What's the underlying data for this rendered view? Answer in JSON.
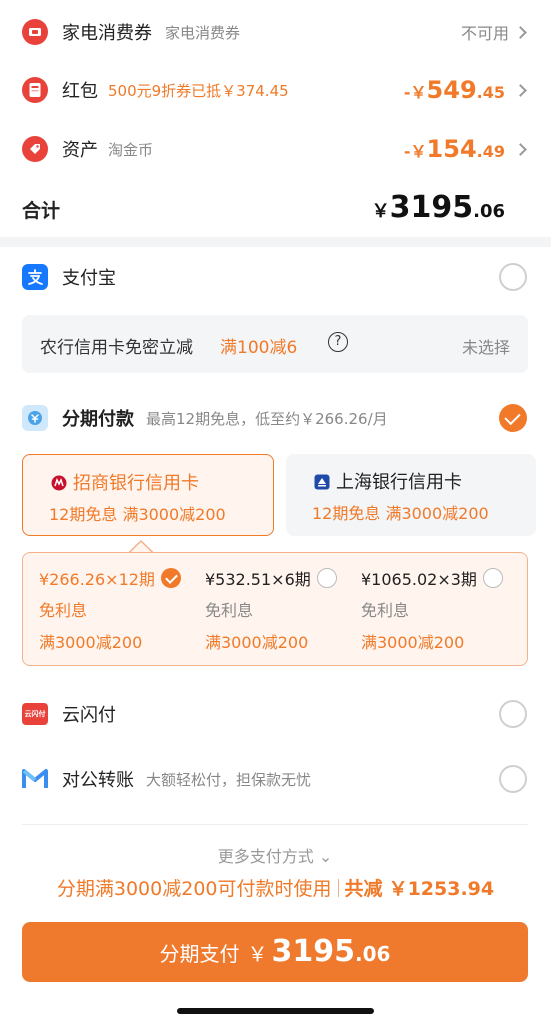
{
  "discounts": {
    "appliance": {
      "label": "家电消费券",
      "sub": "家电消费券",
      "status": "不可用"
    },
    "redpacket": {
      "label": "红包",
      "sub": "500元9折券已抵￥374.45",
      "amount_prefix": "-￥",
      "amount_int": "549",
      "amount_dec": ".45"
    },
    "assets": {
      "label": "资产",
      "sub": "淘金币",
      "amount_prefix": "-￥",
      "amount_int": "154",
      "amount_dec": ".49"
    }
  },
  "total": {
    "label": "合计",
    "currency": "￥",
    "amount_int": "3195",
    "amount_dec": ".06"
  },
  "payment_methods": {
    "alipay": {
      "label": "支付宝"
    },
    "promo": {
      "text": "农行信用卡免密立减",
      "offer": "满100减6",
      "help": "?",
      "status": "未选择"
    },
    "installment": {
      "label": "分期付款",
      "sub": "最高12期免息，低至约￥266.26/月"
    },
    "banks": [
      {
        "name": "招商银行信用卡",
        "offer": "12期免息 满3000减200"
      },
      {
        "name": "上海银行信用卡",
        "offer": "12期免息 满3000减200"
      }
    ],
    "plans": [
      {
        "title": "¥266.26×12期",
        "fee": "免利息",
        "promo": "满3000减200"
      },
      {
        "title": "¥532.51×6期",
        "fee": "免利息",
        "promo": "满3000减200"
      },
      {
        "title": "¥1065.02×3期",
        "fee": "免利息",
        "promo": "满3000减200"
      }
    ],
    "unionpay": {
      "label": "云闪付",
      "logo_text": "云闪付"
    },
    "corporate": {
      "label": "对公转账",
      "sub": "大额轻松付，担保款无忧"
    },
    "more": "更多支付方式 ⌄"
  },
  "bottom": {
    "note": "分期满3000减200可付款时使用",
    "saving_label": "共减",
    "saving_amount": "￥1253.94",
    "pay_label": "分期支付",
    "pay_currency": "￥",
    "pay_int": "3195",
    "pay_dec": ".06"
  },
  "colors": {
    "accent": "#f07a2a",
    "red_icon": "#e8423a",
    "alipay": "#1677ff",
    "cmb": "#c8102e",
    "shbank": "#1f4aa8"
  }
}
